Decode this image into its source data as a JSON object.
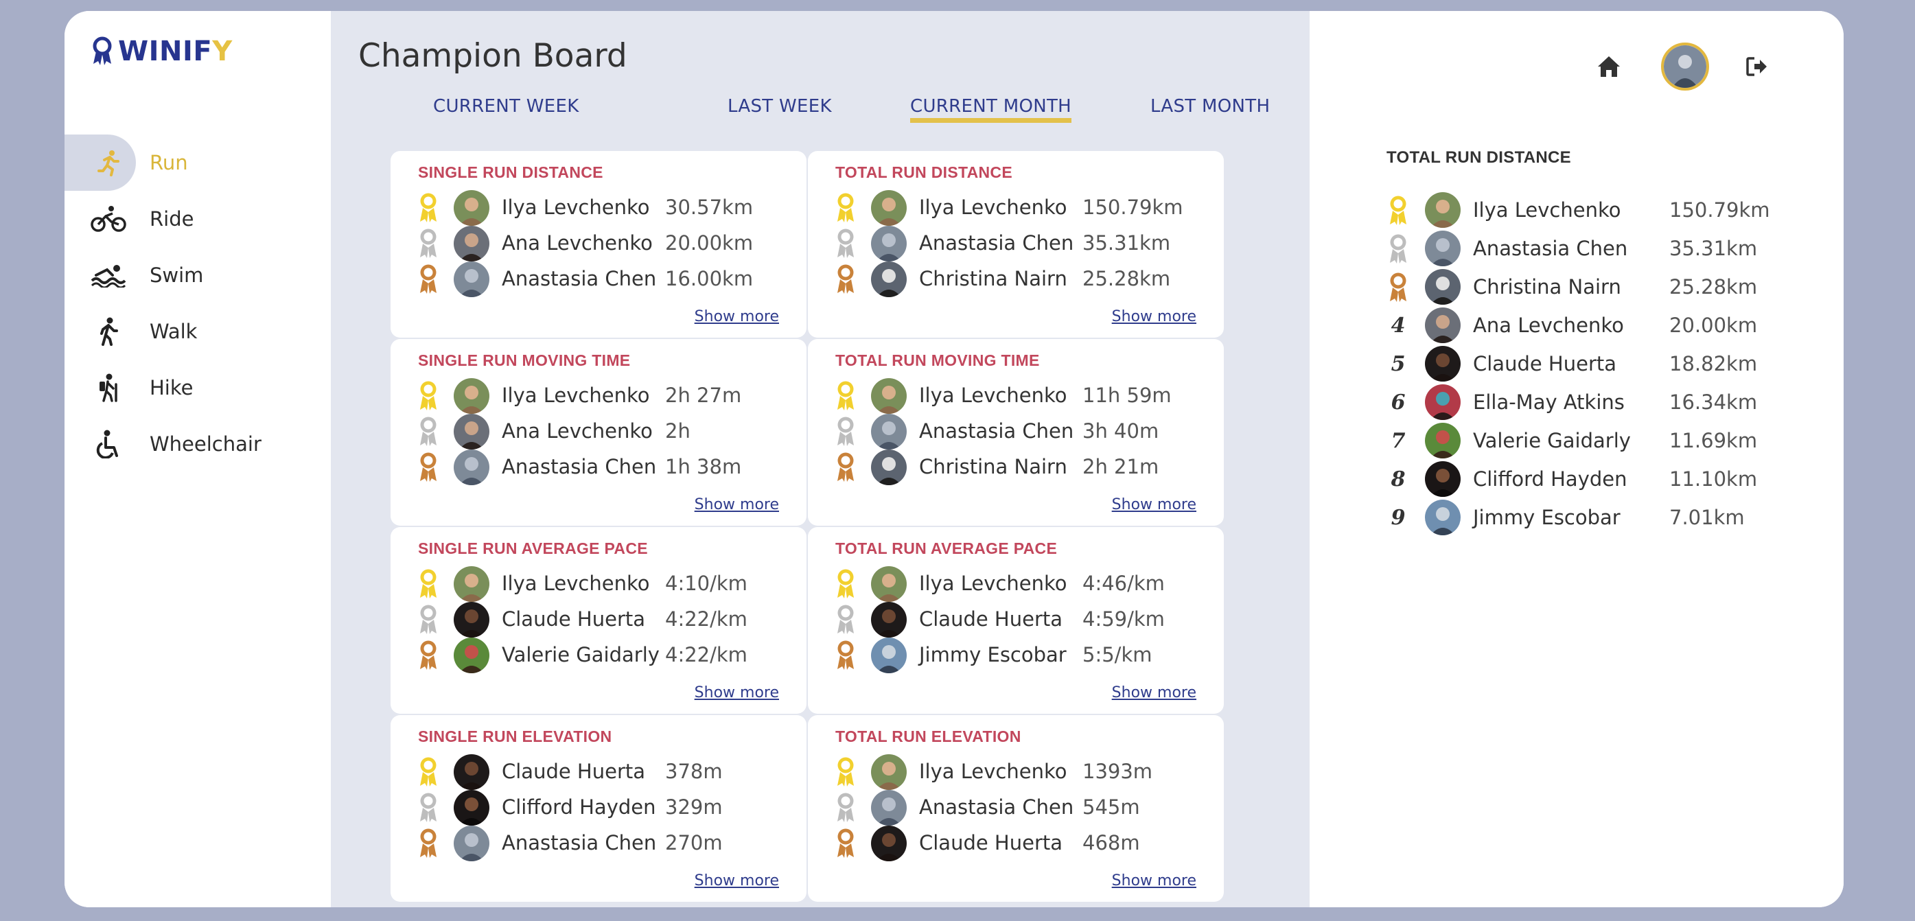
{
  "brand": {
    "part1": "WINIF",
    "part2": "Y"
  },
  "sidebar": {
    "items": [
      {
        "label": "Run",
        "icon": "run-icon",
        "active": true
      },
      {
        "label": "Ride",
        "icon": "bike-icon",
        "active": false
      },
      {
        "label": "Swim",
        "icon": "swim-icon",
        "active": false
      },
      {
        "label": "Walk",
        "icon": "walk-icon",
        "active": false
      },
      {
        "label": "Hike",
        "icon": "hike-icon",
        "active": false
      },
      {
        "label": "Wheelchair",
        "icon": "wheelchair-icon",
        "active": false
      }
    ]
  },
  "main": {
    "title": "Champion Board",
    "tabs": [
      {
        "label": "CURRENT WEEK",
        "active": false
      },
      {
        "label": "LAST WEEK",
        "active": false
      },
      {
        "label": "CURRENT MONTH",
        "active": true
      },
      {
        "label": "LAST MONTH",
        "active": false
      }
    ],
    "show_more": "Show more",
    "cards": [
      {
        "title": "SINGLE RUN DISTANCE",
        "rows": [
          {
            "name": "Ilya Levchenko",
            "value": "30.57km",
            "avatar": "a1"
          },
          {
            "name": "Ana Levchenko",
            "value": "20.00km",
            "avatar": "a2"
          },
          {
            "name": "Anastasia Chen",
            "value": "16.00km",
            "avatar": "a3"
          }
        ]
      },
      {
        "title": "TOTAL RUN DISTANCE",
        "rows": [
          {
            "name": "Ilya Levchenko",
            "value": "150.79km",
            "avatar": "a1"
          },
          {
            "name": "Anastasia Chen",
            "value": "35.31km",
            "avatar": "a3"
          },
          {
            "name": "Christina Nairn",
            "value": "25.28km",
            "avatar": "a4"
          }
        ]
      },
      {
        "title": "SINGLE RUN MOVING TIME",
        "rows": [
          {
            "name": "Ilya Levchenko",
            "value": "2h 27m",
            "avatar": "a1"
          },
          {
            "name": "Ana Levchenko",
            "value": "2h",
            "avatar": "a2"
          },
          {
            "name": "Anastasia Chen",
            "value": "1h 38m",
            "avatar": "a3"
          }
        ]
      },
      {
        "title": "TOTAL RUN MOVING TIME",
        "rows": [
          {
            "name": "Ilya Levchenko",
            "value": "11h 59m",
            "avatar": "a1"
          },
          {
            "name": "Anastasia Chen",
            "value": "3h 40m",
            "avatar": "a3"
          },
          {
            "name": "Christina Nairn",
            "value": "2h 21m",
            "avatar": "a4"
          }
        ]
      },
      {
        "title": "SINGLE RUN AVERAGE PACE",
        "rows": [
          {
            "name": "Ilya Levchenko",
            "value": "4:10/km",
            "avatar": "a1"
          },
          {
            "name": "Claude Huerta",
            "value": "4:22/km",
            "avatar": "a5"
          },
          {
            "name": "Valerie Gaidarly",
            "value": "4:22/km",
            "avatar": "a6"
          }
        ]
      },
      {
        "title": "TOTAL RUN AVERAGE PACE",
        "rows": [
          {
            "name": "Ilya Levchenko",
            "value": "4:46/km",
            "avatar": "a1"
          },
          {
            "name": "Claude Huerta",
            "value": "4:59/km",
            "avatar": "a5"
          },
          {
            "name": "Jimmy Escobar",
            "value": "5:5/km",
            "avatar": "a7"
          }
        ]
      },
      {
        "title": "SINGLE RUN ELEVATION",
        "rows": [
          {
            "name": "Claude Huerta",
            "value": "378m",
            "avatar": "a5"
          },
          {
            "name": "Clifford Hayden",
            "value": "329m",
            "avatar": "a8"
          },
          {
            "name": "Anastasia Chen",
            "value": "270m",
            "avatar": "a3"
          }
        ]
      },
      {
        "title": "TOTAL RUN ELEVATION",
        "rows": [
          {
            "name": "Ilya Levchenko",
            "value": "1393m",
            "avatar": "a1"
          },
          {
            "name": "Anastasia Chen",
            "value": "545m",
            "avatar": "a3"
          },
          {
            "name": "Claude Huerta",
            "value": "468m",
            "avatar": "a5"
          }
        ]
      }
    ]
  },
  "right_panel": {
    "title": "TOTAL RUN DISTANCE",
    "rows": [
      {
        "rank": "",
        "name": "Ilya Levchenko",
        "value": "150.79km",
        "avatar": "a1"
      },
      {
        "rank": "",
        "name": "Anastasia Chen",
        "value": "35.31km",
        "avatar": "a3"
      },
      {
        "rank": "",
        "name": "Christina Nairn",
        "value": "25.28km",
        "avatar": "a4"
      },
      {
        "rank": "4",
        "name": "Ana Levchenko",
        "value": "20.00km",
        "avatar": "a2"
      },
      {
        "rank": "5",
        "name": "Claude Huerta",
        "value": "18.82km",
        "avatar": "a5"
      },
      {
        "rank": "6",
        "name": "Ella-May Atkins",
        "value": "16.34km",
        "avatar": "a9"
      },
      {
        "rank": "7",
        "name": "Valerie Gaidarly",
        "value": "11.69km",
        "avatar": "a6"
      },
      {
        "rank": "8",
        "name": "Clifford Hayden",
        "value": "11.10km",
        "avatar": "a8"
      },
      {
        "rank": "9",
        "name": "Jimmy Escobar",
        "value": "7.01km",
        "avatar": "a7"
      }
    ]
  },
  "colors": {
    "gold": "#f2d02e",
    "silver": "#bdbdbd",
    "bronze": "#c9823a",
    "card_title": "#c2475c",
    "link": "#2f3c8c",
    "accent": "#e3c14b"
  }
}
